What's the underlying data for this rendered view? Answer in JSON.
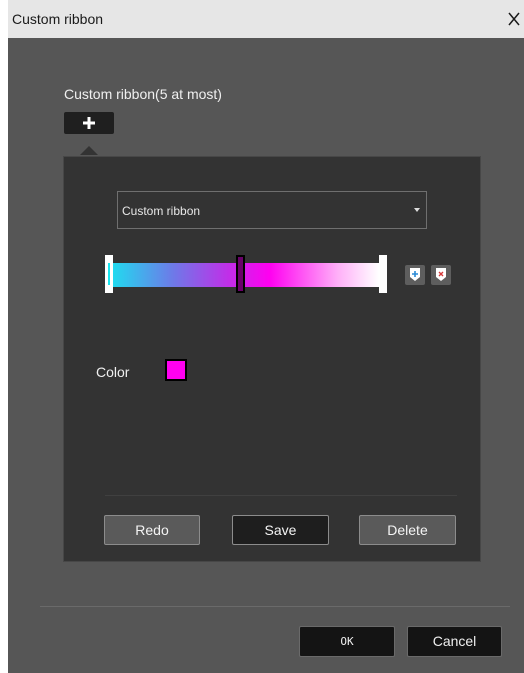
{
  "window": {
    "title": "Custom ribbon"
  },
  "section": {
    "label": "Custom ribbon(5 at most)"
  },
  "panel": {
    "preset_select": {
      "value": "Custom ribbon"
    },
    "gradient": {
      "stops": [
        {
          "name": "left",
          "color": "#18e6f0"
        },
        {
          "name": "middle",
          "color": "#ff00f0",
          "selected": true
        },
        {
          "name": "right",
          "color": "#ffffff"
        }
      ]
    },
    "color": {
      "label": "Color",
      "value": "#ff00f0"
    },
    "buttons": {
      "redo": "Redo",
      "save": "Save",
      "delete": "Delete"
    }
  },
  "footer": {
    "ok": "OK",
    "cancel": "Cancel"
  },
  "icons": {
    "close": "close-icon",
    "add": "plus-icon",
    "add_stop": "add-stop-icon",
    "delete_stop": "delete-stop-icon",
    "dropdown": "chevron-down-icon"
  },
  "colors": {
    "dialog_bg": "#565656",
    "panel_bg": "#333333",
    "titlebar_bg": "#e6e6e6"
  }
}
